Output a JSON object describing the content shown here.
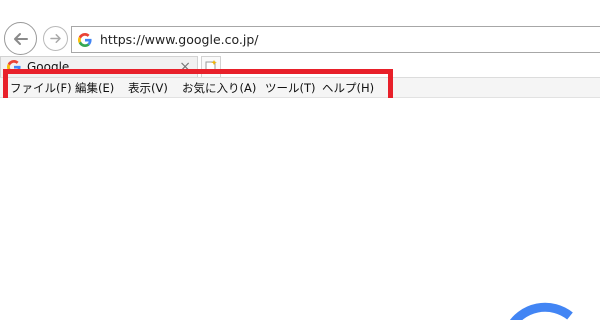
{
  "address_bar": {
    "url": "https://www.google.co.jp/"
  },
  "tab": {
    "title": "Google",
    "close": "×"
  },
  "menu": {
    "items": [
      {
        "label": "ファイル(F)"
      },
      {
        "label": "編集(E)"
      },
      {
        "label": "表示(V)"
      },
      {
        "label": "お気に入り(A)"
      },
      {
        "label": "ツール(T)"
      },
      {
        "label": "ヘルプ(H)"
      }
    ]
  },
  "colors": {
    "highlight": "#e8202a",
    "google_blue": "#4285f4"
  },
  "icons": {
    "back": "back-arrow-icon",
    "forward": "forward-arrow-icon",
    "favicon": "google-g-icon",
    "new_tab": "new-tab-icon"
  }
}
